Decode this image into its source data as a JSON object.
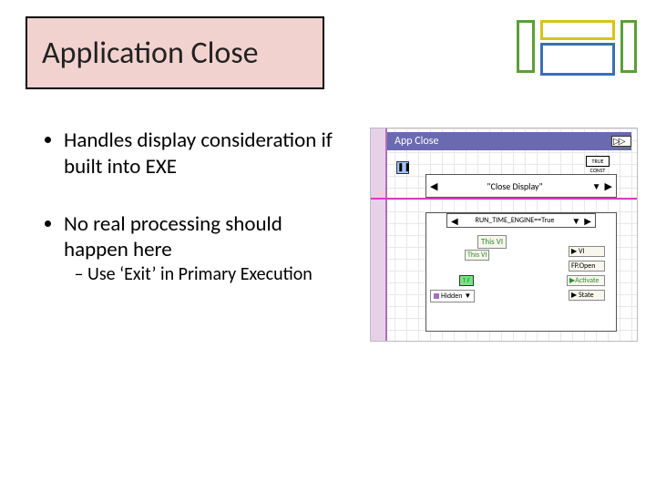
{
  "title": "Application Close",
  "bullets": [
    {
      "text": "Handles display consideration if built into EXE"
    },
    {
      "text": "No real processing should happen here",
      "sub": [
        "Use ‘Exit’ in Primary Execution"
      ]
    }
  ],
  "diagram": {
    "header": "App Close",
    "true_const": "TRUE CONST",
    "case1_label": "\"Close Display\"",
    "case2_label": "RUN_TIME_ENGINE==True",
    "nodes": {
      "this_vi_1": "This VI",
      "this_vi_2": "This VI",
      "vi": "VI",
      "fp_open": "FP.Open",
      "activate": "Activate",
      "state": "State",
      "tf": "T F",
      "hidden": "Hidden"
    },
    "arrows": {
      "left": "◀",
      "right": "▶",
      "down": "▼"
    }
  }
}
